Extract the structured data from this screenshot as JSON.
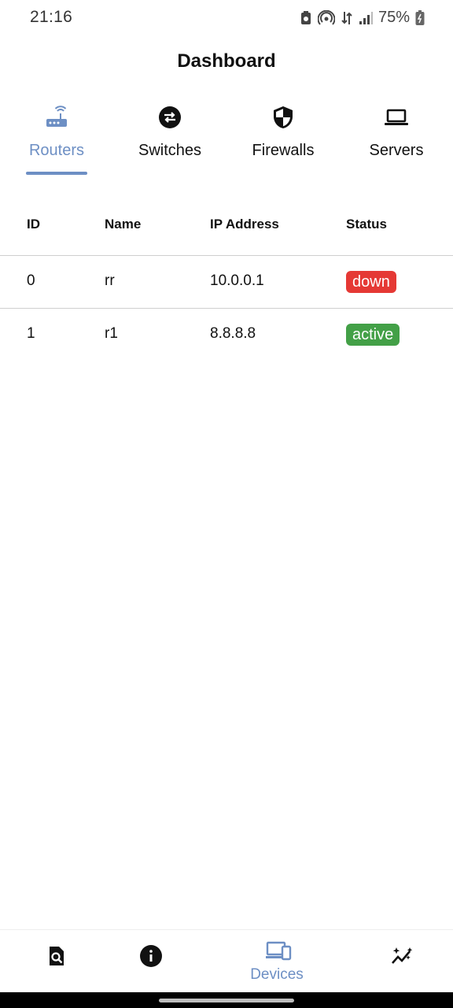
{
  "status_bar": {
    "time": "21:16",
    "battery_text": "75%",
    "icons": [
      "notification-icon",
      "hotspot-icon",
      "data-transfer-icon",
      "signal-icon",
      "battery-icon"
    ]
  },
  "app_bar": {
    "title": "Dashboard"
  },
  "tabs": [
    {
      "label": "Routers",
      "icon": "router-icon",
      "active": true
    },
    {
      "label": "Switches",
      "icon": "switch-icon",
      "active": false
    },
    {
      "label": "Firewalls",
      "icon": "shield-icon",
      "active": false
    },
    {
      "label": "Servers",
      "icon": "laptop-icon",
      "active": false
    }
  ],
  "table": {
    "headers": {
      "id": "ID",
      "name": "Name",
      "ip": "IP Address",
      "status": "Status"
    },
    "rows": [
      {
        "id": "0",
        "name": "rr",
        "ip": "10.0.0.1",
        "status": "down"
      },
      {
        "id": "1",
        "name": "r1",
        "ip": "8.8.8.8",
        "status": "active"
      }
    ]
  },
  "bottom_nav": {
    "items": [
      {
        "icon": "search-document-icon",
        "active": false
      },
      {
        "icon": "info-icon",
        "active": false
      },
      {
        "icon": "devices-icon",
        "label": "Devices",
        "active": true
      },
      {
        "icon": "analytics-icon",
        "active": false
      }
    ]
  },
  "colors": {
    "accent": "#6d8fc4",
    "status_down": "#e53935",
    "status_active": "#43a047"
  }
}
